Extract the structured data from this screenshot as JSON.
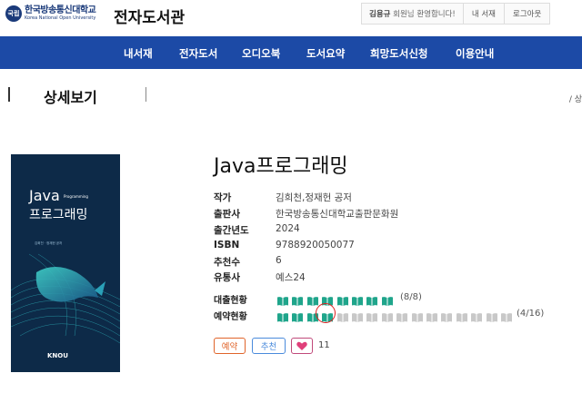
{
  "header": {
    "logo_ko": "한국방송통신대학교",
    "logo_en": "Korea National Open University",
    "logo_emblem": "국립",
    "site_title": "전자도서관",
    "user_name": "김용규",
    "welcome_text": " 회원님 환영합니다!",
    "my_library": "내 서재",
    "logout": "로그아웃"
  },
  "nav": {
    "items": [
      "내서재",
      "전자도서",
      "오디오북",
      "도서요약",
      "희망도서신청",
      "이용안내"
    ]
  },
  "page": {
    "title": "상세보기",
    "breadcrumb": "/ 상"
  },
  "cover": {
    "title_en": "Java",
    "title_en_small": "Programming",
    "title_ko": "프로그래밍",
    "authors": "김희천 · 정재헌 공저",
    "publisher_mark": "KNOU"
  },
  "book": {
    "title": "Java프로그래밍",
    "meta": [
      {
        "label": "작가",
        "value": "김희천,정재헌 공저"
      },
      {
        "label": "출판사",
        "value": "한국방송통신대학교출판문화원"
      },
      {
        "label": "출간년도",
        "value": "2024"
      },
      {
        "label": "ISBN",
        "value": "9788920050077"
      },
      {
        "label": "추천수",
        "value": "6"
      },
      {
        "label": "유통사",
        "value": "예스24"
      }
    ]
  },
  "status": {
    "loan_label": "대출현황",
    "loan_used": 8,
    "loan_total": 8,
    "loan_count": "(8/8)",
    "reserve_label": "예약현황",
    "reserve_used": 4,
    "reserve_total": 16,
    "reserve_count": "(4/16)"
  },
  "actions": {
    "reserve": "예약",
    "recommend": "추천",
    "like_count": "11"
  },
  "colors": {
    "nav_bg": "#1c4aa6",
    "book_filled": "#1fa58b",
    "book_empty": "#c8c8c8",
    "reserve_btn": "#e0642a",
    "recommend_btn": "#4a8bdc",
    "heart": "#e0407a",
    "annotation": "#e02020"
  },
  "icons": [
    "book-icon",
    "heart-icon"
  ]
}
